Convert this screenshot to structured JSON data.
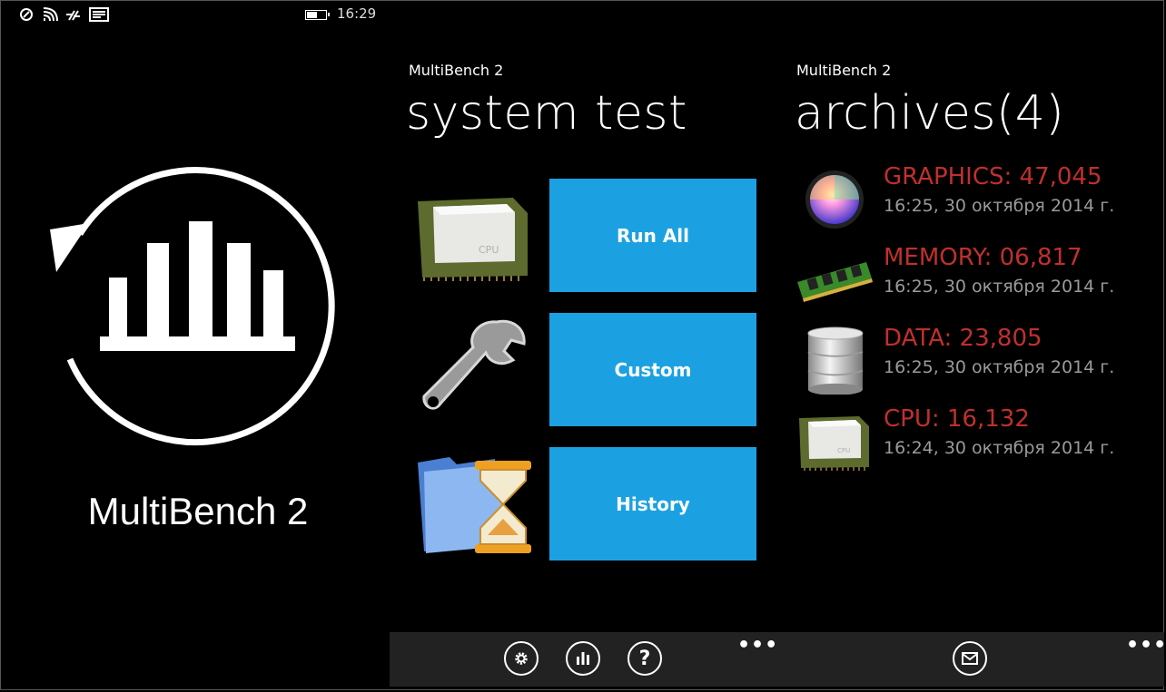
{
  "status": {
    "time": "16:29",
    "battery_level": 0.6
  },
  "splash": {
    "title": "MultiBench 2"
  },
  "system": {
    "app_label": "MultiBench 2",
    "title": "system test",
    "tiles": [
      {
        "label": "Run All",
        "icon": "cpu-chip-icon"
      },
      {
        "label": "Custom",
        "icon": "wrench-icon"
      },
      {
        "label": "History",
        "icon": "folder-hourglass-icon"
      }
    ],
    "cpu_chip_text": "CPU"
  },
  "archives": {
    "app_label": "MultiBench 2",
    "title": "archives(4)",
    "items": [
      {
        "title": "GRAPHICS: 47,045",
        "time": "16:25, 30 октября 2014 г.",
        "icon": "color-sphere-icon"
      },
      {
        "title": "MEMORY: 06,817",
        "time": "16:25, 30 октября 2014 г.",
        "icon": "memory-module-icon"
      },
      {
        "title": "DATA: 23,805",
        "time": "16:25, 30 октября 2014 г.",
        "icon": "database-icon"
      },
      {
        "title": "CPU: 16,132",
        "time": "16:24, 30 октября 2014 г.",
        "icon": "cpu-chip-icon"
      }
    ]
  },
  "appbar": {
    "more": "•••",
    "help_glyph": "?"
  },
  "colors": {
    "accent": "#1ba1e2",
    "score_red": "#c0302c",
    "appbar_bg": "#222222"
  }
}
